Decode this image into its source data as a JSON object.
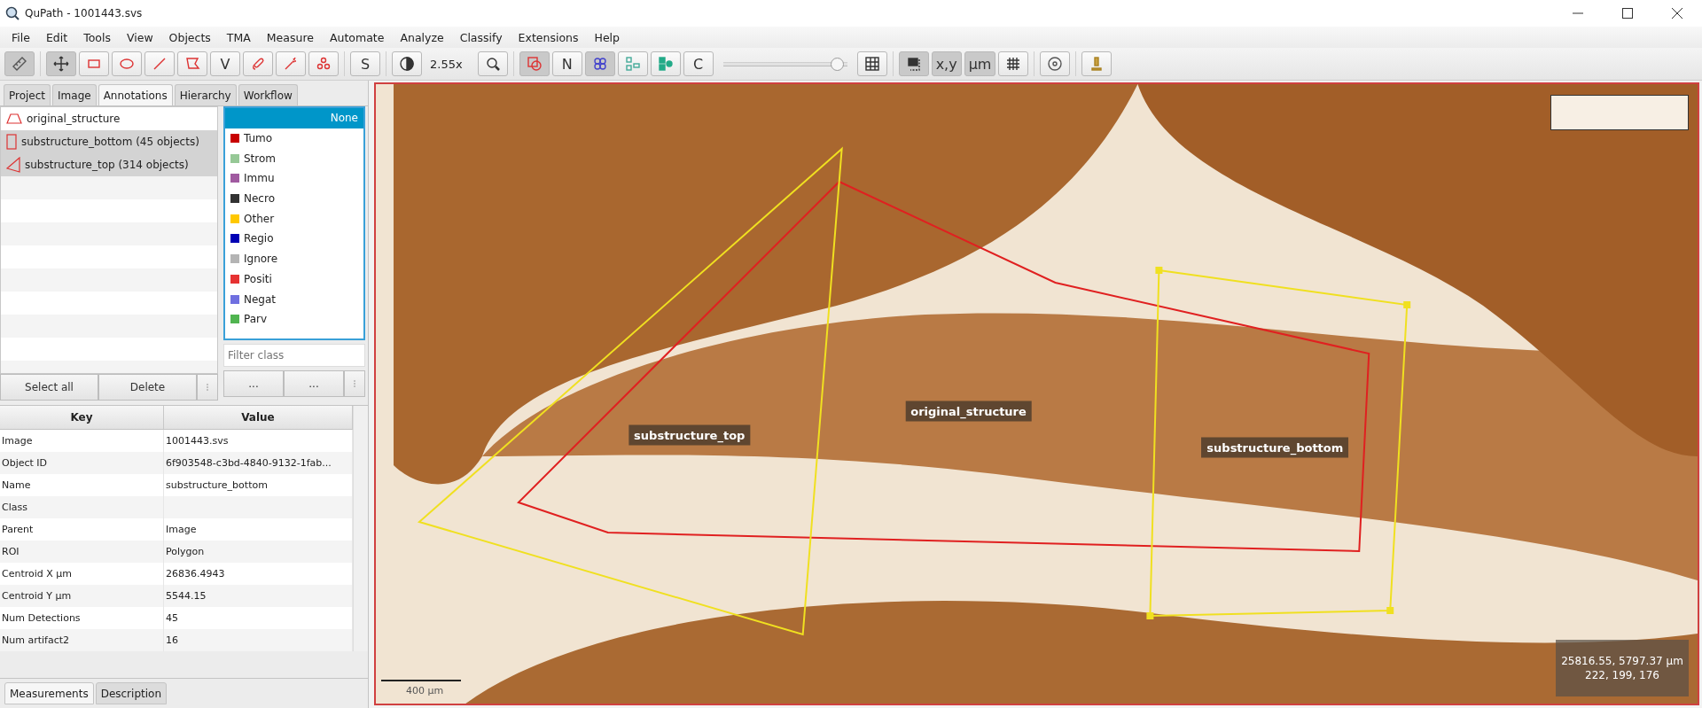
{
  "window": {
    "title": "QuPath - 1001443.svs"
  },
  "menu": [
    "File",
    "Edit",
    "Tools",
    "View",
    "Objects",
    "TMA",
    "Measure",
    "Automate",
    "Analyze",
    "Classify",
    "Extensions",
    "Help"
  ],
  "toolbar": {
    "groups": [
      [
        {
          "kind": "button",
          "selected": true
        }
      ],
      [
        {
          "kind": "button",
          "selected": true
        },
        {
          "kind": "button",
          "selected": false
        },
        {
          "kind": "button",
          "selected": false
        },
        {
          "kind": "button",
          "selected": false
        },
        {
          "kind": "button",
          "selected": false
        },
        {
          "kind": "button",
          "selected": false,
          "label": "V"
        },
        {
          "kind": "button",
          "selected": false
        },
        {
          "kind": "button",
          "selected": false
        },
        {
          "kind": "button",
          "selected": false
        }
      ],
      [
        {
          "kind": "button",
          "selected": false,
          "label": "S"
        }
      ],
      [
        {
          "kind": "button",
          "selected": false
        },
        {
          "kind": "readout",
          "label": "2.55x"
        },
        {
          "kind": "button",
          "selected": false
        }
      ],
      [
        {
          "kind": "button",
          "selected": true
        },
        {
          "kind": "button",
          "selected": false,
          "label": "N"
        },
        {
          "kind": "button",
          "selected": true
        },
        {
          "kind": "button",
          "selected": false
        },
        {
          "kind": "button",
          "selected": false
        },
        {
          "kind": "button",
          "selected": false,
          "label": "C"
        },
        {
          "kind": "slider",
          "level": 0.97
        },
        {
          "kind": "button",
          "selected": false
        }
      ],
      [
        {
          "kind": "button",
          "selected": true
        },
        {
          "kind": "button",
          "selected": true,
          "label": "x,y"
        },
        {
          "kind": "button",
          "selected": true,
          "label": "µm"
        },
        {
          "kind": "button",
          "selected": false
        }
      ],
      [
        {
          "kind": "button",
          "selected": false
        }
      ],
      [
        {
          "kind": "button",
          "selected": false
        }
      ]
    ]
  },
  "left_tabs": [
    {
      "label": "Project",
      "selected": false
    },
    {
      "label": "Image",
      "selected": false
    },
    {
      "label": "Annotations",
      "selected": true
    },
    {
      "label": "Hierarchy",
      "selected": false
    },
    {
      "label": "Workflow",
      "selected": false
    }
  ],
  "annotations": [
    {
      "kind": "polygon",
      "label": "original_structure",
      "selected": false
    },
    {
      "kind": "rectangle",
      "label": "substructure_bottom (45 objects)",
      "selected": true
    },
    {
      "kind": "triangle",
      "label": "substructure_top (314 objects)",
      "selected": true
    }
  ],
  "classes": [
    {
      "label": "None",
      "selected": true
    },
    {
      "label": "Tumo",
      "color": "#c80000",
      "selected": false
    },
    {
      "label": "Strom",
      "color": "#96c896",
      "selected": false
    },
    {
      "label": "Immu",
      "color": "#a05aa0",
      "selected": false
    },
    {
      "label": "Necro",
      "color": "#323232",
      "selected": false
    },
    {
      "label": "Other",
      "color": "#ffc800",
      "selected": false
    },
    {
      "label": "Regio",
      "color": "#0000b4",
      "selected": false
    },
    {
      "label": "Ignore",
      "color": "#b4b4b4",
      "selected": false
    },
    {
      "label": "Positi",
      "color": "#e63232",
      "selected": false
    },
    {
      "label": "Negat",
      "color": "#7070e0",
      "selected": false
    },
    {
      "label": "Parv",
      "color": "#50b450",
      "selected": false
    }
  ],
  "class_filter": {
    "placeholder": "Filter class"
  },
  "class_buttons": [
    "...",
    "..."
  ],
  "list_buttons": [
    "Select all",
    "Delete"
  ],
  "measurements": {
    "columns": [
      "Key",
      "Value"
    ],
    "rows": [
      {
        "key": "Image",
        "value": "1001443.svs"
      },
      {
        "key": "Object ID",
        "value": "6f903548-c3bd-4840-9132-1fab..."
      },
      {
        "key": "Name",
        "value": "substructure_bottom"
      },
      {
        "key": "Class"
      },
      {
        "key": "Parent",
        "value": "Image"
      },
      {
        "key": "ROI",
        "value": "Polygon"
      },
      {
        "key": "Centroid X µm",
        "value": "26836.4943"
      },
      {
        "key": "Centroid Y µm",
        "value": "5544.15"
      },
      {
        "key": "Num Detections",
        "value": "45"
      },
      {
        "key": "Num artifact2",
        "value": "16"
      }
    ]
  },
  "bottom_tabs": [
    {
      "label": "Measurements",
      "selected": true
    },
    {
      "label": "Description",
      "selected": false
    }
  ],
  "viewer": {
    "annotations": [
      {
        "label": "original_structure",
        "selected": false,
        "handles": false
      },
      {
        "label": "substructure_top",
        "selected": true,
        "handles": false
      },
      {
        "label": "substructure_bottom",
        "selected": true,
        "handles": true
      }
    ],
    "scale_bar": "400 µm",
    "cursor_position": "25816.55, 5797.37 µm",
    "pixel_value": "222, 199, 176"
  }
}
